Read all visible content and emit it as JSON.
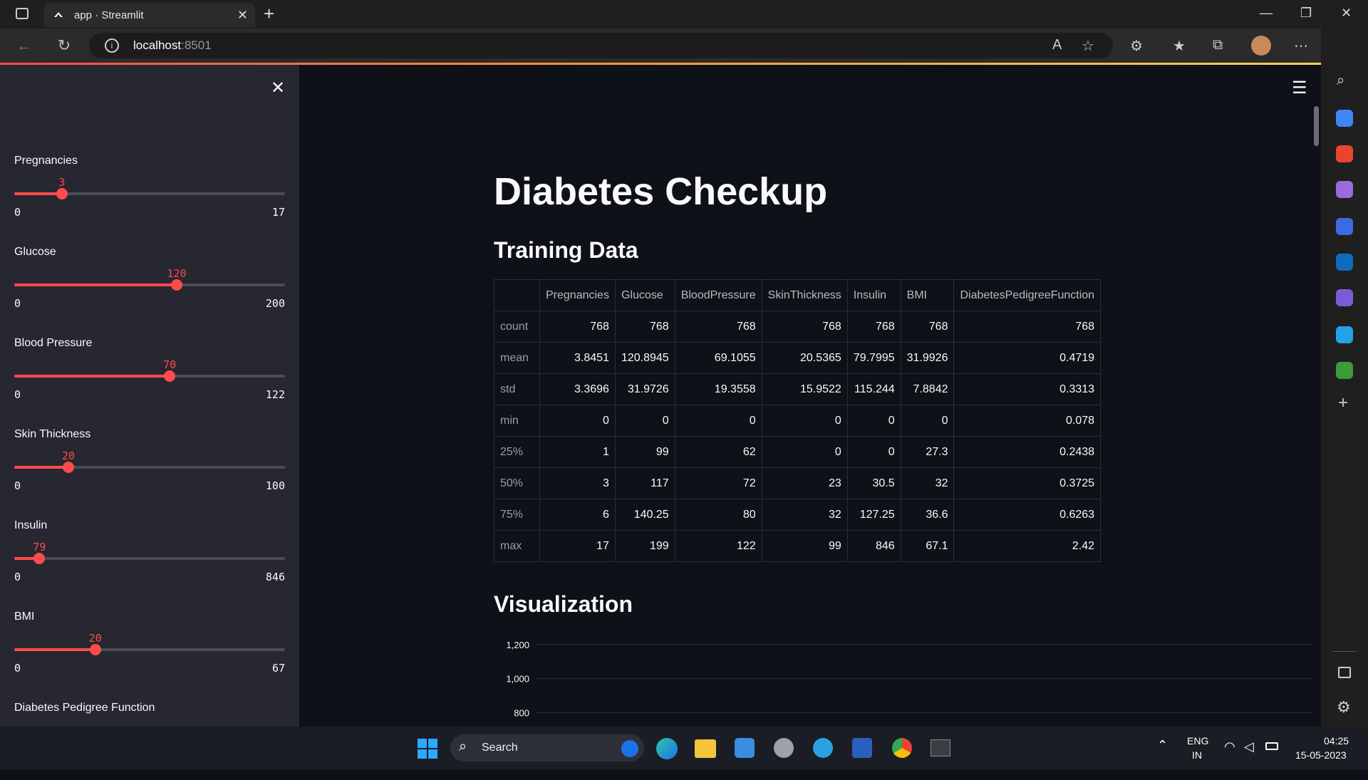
{
  "browser": {
    "tab_title": "app · Streamlit",
    "url_host": "localhost",
    "url_port": ":8501"
  },
  "sidebar": {
    "sliders": [
      {
        "label": "Pregnancies",
        "value": "3",
        "min": "0",
        "max": "17",
        "fraction": 0.176
      },
      {
        "label": "Glucose",
        "value": "120",
        "min": "0",
        "max": "200",
        "fraction": 0.6
      },
      {
        "label": "Blood Pressure",
        "value": "70",
        "min": "0",
        "max": "122",
        "fraction": 0.574
      },
      {
        "label": "Skin Thickness",
        "value": "20",
        "min": "0",
        "max": "100",
        "fraction": 0.2
      },
      {
        "label": "Insulin",
        "value": "79",
        "min": "0",
        "max": "846",
        "fraction": 0.093
      },
      {
        "label": "BMI",
        "value": "20",
        "min": "0",
        "max": "67",
        "fraction": 0.299
      },
      {
        "label": "Diabetes Pedigree Function"
      }
    ]
  },
  "main": {
    "title": "Diabetes Checkup",
    "training_heading": "Training Data",
    "viz_heading": "Visualization",
    "table": {
      "columns": [
        "",
        "Pregnancies",
        "Glucose",
        "BloodPressure",
        "SkinThickness",
        "Insulin",
        "BMI",
        "DiabetesPedigreeFunction"
      ],
      "rows": [
        [
          "count",
          "768",
          "768",
          "768",
          "768",
          "768",
          "768",
          "768"
        ],
        [
          "mean",
          "3.8451",
          "120.8945",
          "69.1055",
          "20.5365",
          "79.7995",
          "31.9926",
          "0.4719"
        ],
        [
          "std",
          "3.3696",
          "31.9726",
          "19.3558",
          "15.9522",
          "115.244",
          "7.8842",
          "0.3313"
        ],
        [
          "min",
          "0",
          "0",
          "0",
          "0",
          "0",
          "0",
          "0.078"
        ],
        [
          "25%",
          "1",
          "99",
          "62",
          "0",
          "0",
          "27.3",
          "0.2438"
        ],
        [
          "50%",
          "3",
          "117",
          "72",
          "23",
          "30.5",
          "32",
          "0.3725"
        ],
        [
          "75%",
          "6",
          "140.25",
          "80",
          "32",
          "127.25",
          "36.6",
          "0.6263"
        ],
        [
          "max",
          "17",
          "199",
          "122",
          "99",
          "846",
          "67.1",
          "2.42"
        ]
      ]
    }
  },
  "chart_data": {
    "type": "bar",
    "ticks": [
      "1,200",
      "1,000",
      "800"
    ],
    "tick_values": [
      1200,
      1000,
      800
    ],
    "ylim": [
      760,
      1220
    ]
  },
  "taskbar": {
    "search_label": "Search",
    "lang_1": "ENG",
    "lang_2": "IN",
    "time": "04:25",
    "date": "15-05-2023"
  }
}
